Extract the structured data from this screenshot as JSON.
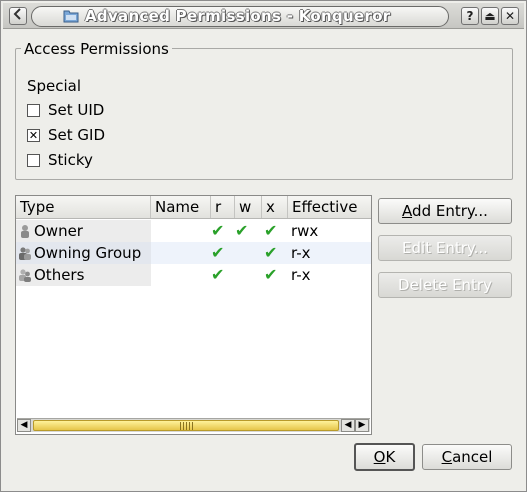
{
  "window": {
    "title": "Advanced Permissions - Konqueror",
    "buttons": {
      "help": "?",
      "shade": "⏏",
      "close": "✕"
    }
  },
  "access": {
    "group_title": "Access Permissions",
    "special_label": "Special",
    "checkboxes": [
      {
        "label": "Set UID",
        "checked": false
      },
      {
        "label": "Set GID",
        "checked": true
      },
      {
        "label": "Sticky",
        "checked": false
      }
    ]
  },
  "list": {
    "columns": [
      "Type",
      "Name",
      "r",
      "w",
      "x",
      "Effective"
    ],
    "rows": [
      {
        "type": "Owner",
        "icon": "user-icon",
        "name": "",
        "r": true,
        "w": true,
        "x": true,
        "effective": "rwx"
      },
      {
        "type": "Owning Group",
        "icon": "group-icon",
        "name": "",
        "r": true,
        "w": false,
        "x": true,
        "effective": "r-x"
      },
      {
        "type": "Others",
        "icon": "others-icon",
        "name": "",
        "r": true,
        "w": false,
        "x": true,
        "effective": "r-x"
      }
    ],
    "check_glyph": "✔"
  },
  "side_buttons": {
    "add_prefix": "A",
    "add_rest": "dd Entry...",
    "edit": "Edit Entry...",
    "delete": "Delete Entry"
  },
  "footer": {
    "ok_prefix": "O",
    "ok_rest": "K",
    "cancel_prefix": "C",
    "cancel_rest": "ancel"
  }
}
